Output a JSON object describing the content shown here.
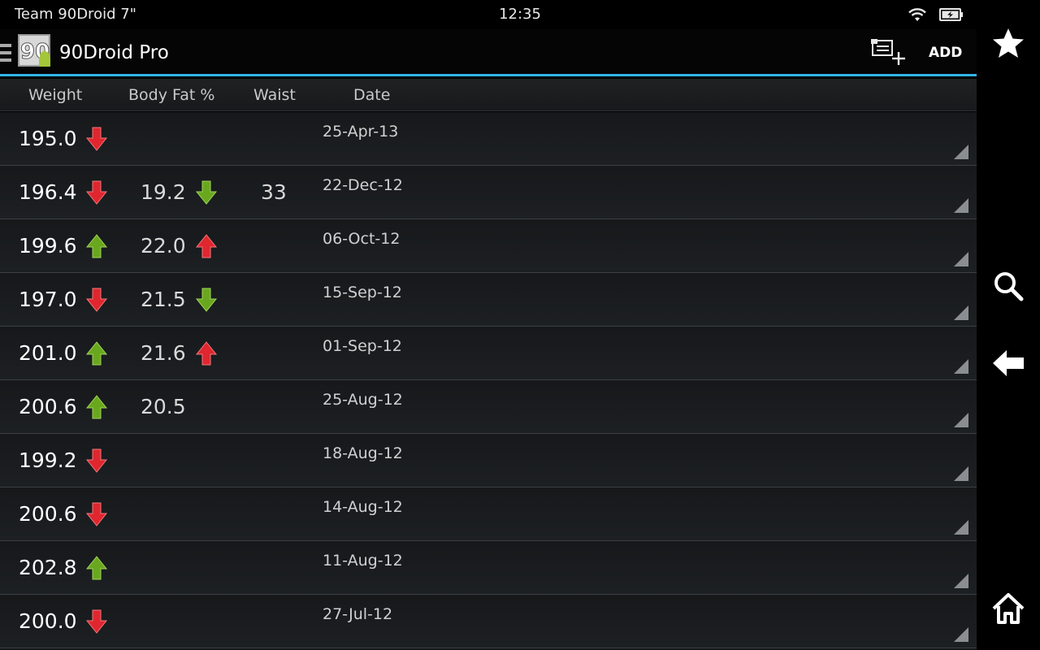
{
  "status_bar": {
    "device_name": "Team 90Droid 7\"",
    "time": "12:35",
    "icons": [
      "wifi-icon",
      "battery-charging-icon"
    ]
  },
  "action_bar": {
    "title": "90Droid Pro",
    "logo_text": "90",
    "add_label": "ADD",
    "icons": [
      "drawer-indicator-icon",
      "add-photo-icon"
    ]
  },
  "columns": {
    "weight": "Weight",
    "body_fat": "Body Fat %",
    "waist": "Waist",
    "date": "Date"
  },
  "colors": {
    "accent": "#33b5e5",
    "arrow_down_red": "#e0262e",
    "arrow_up_green": "#69a81e"
  },
  "rows": [
    {
      "weight": "195.0",
      "weight_trend": "down-red",
      "body_fat": "",
      "bf_trend": "",
      "waist": "",
      "date": "25-Apr-13"
    },
    {
      "weight": "196.4",
      "weight_trend": "down-red",
      "body_fat": "19.2",
      "bf_trend": "down-green",
      "waist": "33",
      "date": "22-Dec-12"
    },
    {
      "weight": "199.6",
      "weight_trend": "up-green",
      "body_fat": "22.0",
      "bf_trend": "up-red",
      "waist": "",
      "date": "06-Oct-12"
    },
    {
      "weight": "197.0",
      "weight_trend": "down-red",
      "body_fat": "21.5",
      "bf_trend": "down-green",
      "waist": "",
      "date": "15-Sep-12"
    },
    {
      "weight": "201.0",
      "weight_trend": "up-green",
      "body_fat": "21.6",
      "bf_trend": "up-red",
      "waist": "",
      "date": "01-Sep-12"
    },
    {
      "weight": "200.6",
      "weight_trend": "up-green",
      "body_fat": "20.5",
      "bf_trend": "",
      "waist": "",
      "date": "25-Aug-12"
    },
    {
      "weight": "199.2",
      "weight_trend": "down-red",
      "body_fat": "",
      "bf_trend": "",
      "waist": "",
      "date": "18-Aug-12"
    },
    {
      "weight": "200.6",
      "weight_trend": "down-red",
      "body_fat": "",
      "bf_trend": "",
      "waist": "",
      "date": "14-Aug-12"
    },
    {
      "weight": "202.8",
      "weight_trend": "up-green",
      "body_fat": "",
      "bf_trend": "",
      "waist": "",
      "date": "11-Aug-12"
    },
    {
      "weight": "200.0",
      "weight_trend": "down-red",
      "body_fat": "",
      "bf_trend": "",
      "waist": "",
      "date": "27-Jul-12"
    }
  ],
  "nav_bar": {
    "icons": [
      "star-icon",
      "search-icon",
      "back-arrow-icon",
      "home-icon"
    ]
  }
}
